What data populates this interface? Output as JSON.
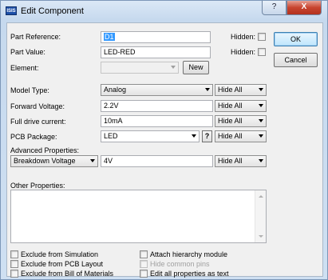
{
  "window": {
    "icon_text": "ISIS",
    "title": "Edit Component",
    "help_glyph": "?",
    "close_glyph": "X"
  },
  "fields": {
    "part_reference": {
      "label": "Part Reference:",
      "value": "D1"
    },
    "part_value": {
      "label": "Part Value:",
      "value": "LED-RED"
    },
    "element": {
      "label": "Element:",
      "value": ""
    },
    "new_button": "New",
    "hidden_label": "Hidden:"
  },
  "buttons": {
    "ok": "OK",
    "cancel": "Cancel"
  },
  "properties": {
    "model_type": {
      "label": "Model Type:",
      "value": "Analog",
      "visibility": "Hide All"
    },
    "forward_voltage": {
      "label": "Forward Voltage:",
      "value": "2.2V",
      "visibility": "Hide All"
    },
    "full_drive_current": {
      "label": "Full drive current:",
      "value": "10mA",
      "visibility": "Hide All"
    },
    "pcb_package": {
      "label": "PCB Package:",
      "value": "LED",
      "help": "?",
      "visibility": "Hide All"
    }
  },
  "advanced": {
    "label": "Advanced Properties:",
    "property": "Breakdown Voltage",
    "value": "4V",
    "visibility": "Hide All"
  },
  "other": {
    "label": "Other Properties:",
    "text": ""
  },
  "options": {
    "exclude_simulation": {
      "label": "Exclude from Simulation",
      "checked": false
    },
    "exclude_pcb": {
      "label": "Exclude from PCB Layout",
      "checked": false
    },
    "exclude_bom": {
      "label": "Exclude from Bill of Materials",
      "checked": false
    },
    "attach_hierarchy": {
      "label": "Attach hierarchy module",
      "checked": false
    },
    "hide_common_pins": {
      "label": "Hide common pins",
      "checked": false,
      "disabled": true
    },
    "edit_all_text": {
      "label": "Edit all properties as text",
      "checked": false
    }
  }
}
